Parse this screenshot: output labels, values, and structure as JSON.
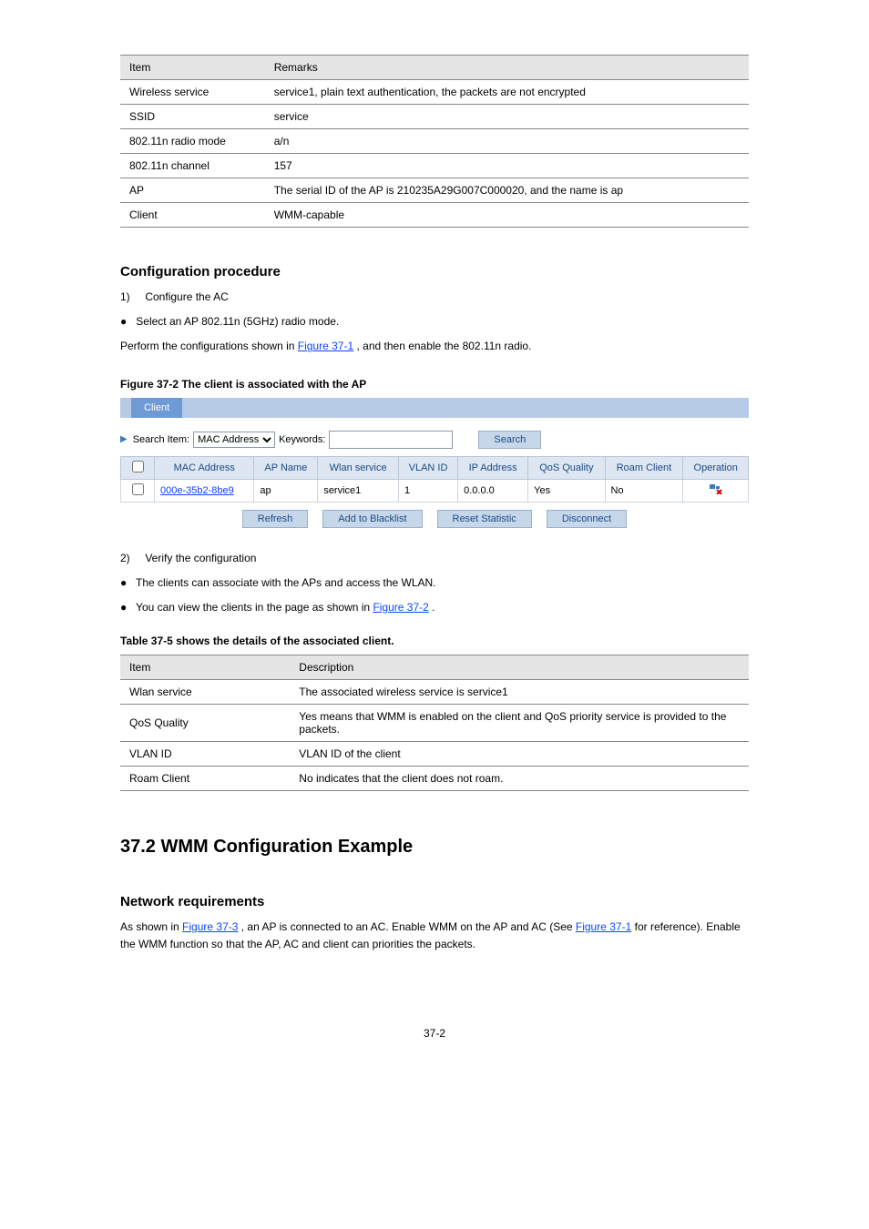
{
  "table1": {
    "head": [
      "Item",
      "Remarks"
    ],
    "rows": [
      [
        "Wireless service",
        "service1, plain text authentication, the packets are not encrypted"
      ],
      [
        "SSID",
        "service"
      ],
      [
        "802.11n radio mode",
        "a/n"
      ],
      [
        "802.11n channel",
        "157"
      ],
      [
        "AP",
        "The serial ID of the AP is 210235A29G007C000020, and the name is ap"
      ],
      [
        "Client",
        "WMM-capable"
      ]
    ]
  },
  "sectionTitle": "Configuration procedure",
  "step1": {
    "num": "1)",
    "text": "Configure the AC",
    "bullets": [
      "Select an AP 802.11n (5GHz) radio mode."
    ]
  },
  "para1": {
    "lead": "Perform the configurations shown in ",
    "linkText": "Figure 37-1",
    "tail": ", and then enable the 802.11n radio."
  },
  "figure37": {
    "caption": "Figure 37-2 The client is associated with the AP",
    "tabLabel": "Client",
    "searchLabel": "Search Item:",
    "selectValue": "MAC Address",
    "keywordsLabel": "Keywords:",
    "searchBtn": "Search",
    "headers": [
      "",
      "MAC Address",
      "AP Name",
      "Wlan service",
      "VLAN ID",
      "IP Address",
      "QoS Quality",
      "Roam Client",
      "Operation"
    ],
    "row": {
      "mac": "000e-35b2-8be9",
      "ap": "ap",
      "wlan": "service1",
      "vlan": "1",
      "ip": "0.0.0.0",
      "qos": "Yes",
      "roam": "No"
    },
    "buttons": [
      "Refresh",
      "Add to Blacklist",
      "Reset Statistic",
      "Disconnect"
    ]
  },
  "step2": {
    "num": "2)",
    "text": "Verify the configuration",
    "bullets": [
      {
        "lead": "The clients can associate with the APs and access the WLAN."
      },
      {
        "lead": "You can view the clients in the page as shown in ",
        "link": "Figure 37-2",
        "tail": "."
      }
    ]
  },
  "table37": {
    "caption": "Table 37-5 shows the details of the associated client.",
    "head": [
      "Item",
      "Description"
    ],
    "rows": [
      [
        "Wlan service",
        "The associated wireless service is service1"
      ],
      [
        "QoS Quality",
        "Yes means that WMM is enabled on the client and QoS priority service is provided to the packets."
      ],
      [
        "VLAN ID",
        "VLAN ID of the client"
      ],
      [
        "Roam Client",
        "No indicates that the client does not roam."
      ]
    ]
  },
  "h2": "37.2  WMM Configuration Example",
  "netReqTitle": "Network requirements",
  "netReqParas": [
    {
      "lead": "As shown in ",
      "link": "Figure 37-3",
      "tail": ", an AP is connected to an AC. Enable WMM on the AP and AC (See "
    },
    {
      "leadOnly": "",
      "link2": "Figure 37-1",
      "tail2": " for reference). Enable the WMM function so that the AP, AC and client can priorities the packets."
    }
  ],
  "pageNumber": "37-2"
}
